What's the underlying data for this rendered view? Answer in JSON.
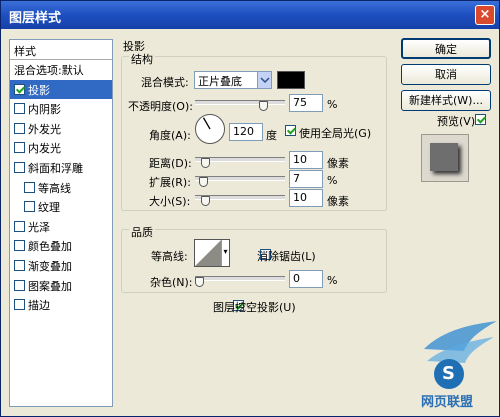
{
  "window": {
    "title": "图层样式",
    "close_glyph": "×"
  },
  "styles_panel": {
    "header": "样式",
    "items": [
      {
        "label": "混合选项:默认",
        "checkbox": false,
        "selected": false,
        "indent": false
      },
      {
        "label": "投影",
        "checkbox": true,
        "checked": true,
        "selected": true,
        "indent": false
      },
      {
        "label": "内阴影",
        "checkbox": true,
        "checked": false,
        "selected": false,
        "indent": false
      },
      {
        "label": "外发光",
        "checkbox": true,
        "checked": false,
        "selected": false,
        "indent": false
      },
      {
        "label": "内发光",
        "checkbox": true,
        "checked": false,
        "selected": false,
        "indent": false
      },
      {
        "label": "斜面和浮雕",
        "checkbox": true,
        "checked": false,
        "selected": false,
        "indent": false
      },
      {
        "label": "等高线",
        "checkbox": true,
        "checked": false,
        "selected": false,
        "indent": true
      },
      {
        "label": "纹理",
        "checkbox": true,
        "checked": false,
        "selected": false,
        "indent": true
      },
      {
        "label": "光泽",
        "checkbox": true,
        "checked": false,
        "selected": false,
        "indent": false
      },
      {
        "label": "颜色叠加",
        "checkbox": true,
        "checked": false,
        "selected": false,
        "indent": false
      },
      {
        "label": "渐变叠加",
        "checkbox": true,
        "checked": false,
        "selected": false,
        "indent": false
      },
      {
        "label": "图案叠加",
        "checkbox": true,
        "checked": false,
        "selected": false,
        "indent": false
      },
      {
        "label": "描边",
        "checkbox": true,
        "checked": false,
        "selected": false,
        "indent": false
      }
    ]
  },
  "drop_shadow": {
    "section_title": "投影",
    "structure": {
      "title": "结构",
      "blend_mode_label": "混合模式:",
      "blend_mode_value": "正片叠底",
      "shadow_color": "#000000",
      "opacity_label": "不透明度(O):",
      "opacity_value": "75",
      "opacity_unit": "%",
      "opacity_fraction": 0.75,
      "angle_label": "角度(A):",
      "angle_value": "120",
      "angle_unit": "度",
      "global_light_label": "使用全局光(G)",
      "global_light_checked": true,
      "distance_label": "距离(D):",
      "distance_value": "10",
      "distance_unit": "像素",
      "spread_label": "扩展(R):",
      "spread_value": "7",
      "spread_unit": "%",
      "size_label": "大小(S):",
      "size_value": "10",
      "size_unit": "像素"
    },
    "quality": {
      "title": "品质",
      "contour_label": "等高线:",
      "anti_alias_label": "消除锯齿(L)",
      "anti_alias_checked": false,
      "noise_label": "杂色(N):",
      "noise_value": "0",
      "noise_unit": "%"
    },
    "knockout_label": "图层挖空投影(U)",
    "knockout_checked": true
  },
  "buttons": {
    "ok": "确定",
    "cancel": "取消",
    "new_style": "新建样式(W)...",
    "preview_label": "预览(V)",
    "preview_checked": true
  },
  "watermark": {
    "logo_text": "S",
    "site_text": "网页联盟"
  }
}
